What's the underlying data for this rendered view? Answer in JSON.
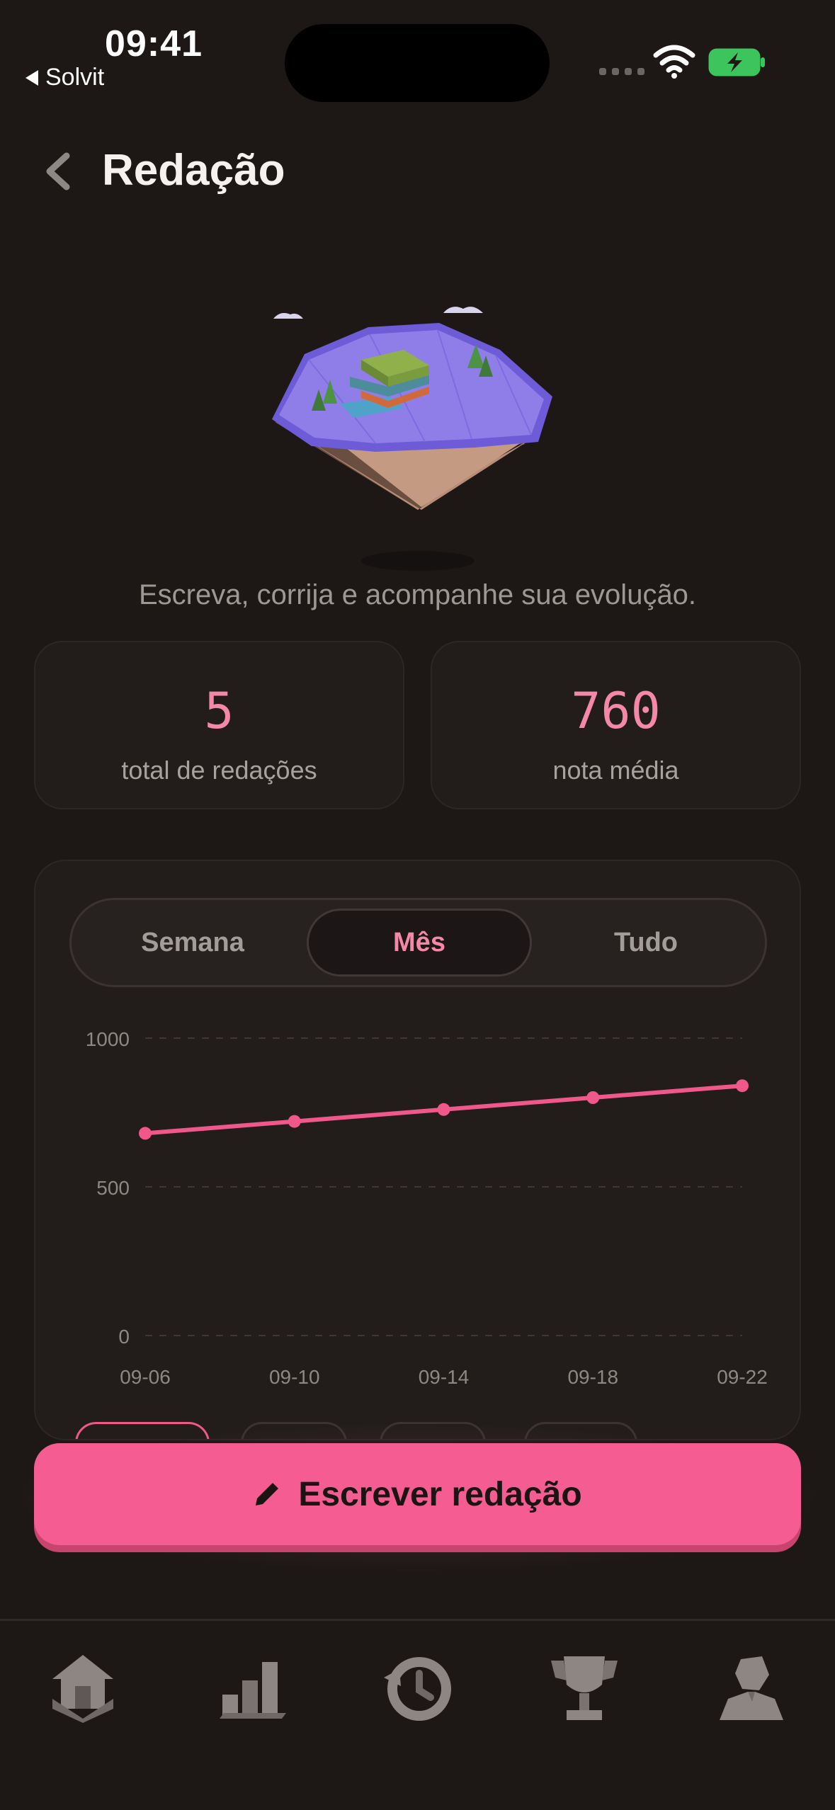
{
  "status_bar": {
    "time": "09:41",
    "back_app": "Solvit"
  },
  "header": {
    "title": "Redação"
  },
  "hero": {
    "subtitle": "Escreva, corrija e acompanhe sua evolução."
  },
  "stats": [
    {
      "value": "5",
      "label": "total de redações"
    },
    {
      "value": "760",
      "label": "nota média"
    }
  ],
  "period_tabs": {
    "items": [
      "Semana",
      "Mês",
      "Tudo"
    ],
    "selected": "Mês"
  },
  "chart_data": {
    "type": "line",
    "categories": [
      "09-06",
      "09-10",
      "09-14",
      "09-18",
      "09-22"
    ],
    "series": [
      {
        "values": [
          680,
          720,
          760,
          800,
          840
        ]
      }
    ],
    "y_ticks": [
      "1000",
      "500",
      "0"
    ],
    "ylim": [
      0,
      1000
    ],
    "grid": true,
    "line_color": "#f0588c"
  },
  "cta": {
    "label": "Escrever redação",
    "icon": "pencil-icon"
  },
  "tabbar": {
    "icons": [
      "home-icon",
      "stats-icon",
      "history-icon",
      "trophy-icon",
      "profile-icon"
    ]
  },
  "colors": {
    "accent": "#f55d92",
    "accent_text": "#f587a8",
    "background": "#1d1816",
    "card": "#221d1b"
  }
}
